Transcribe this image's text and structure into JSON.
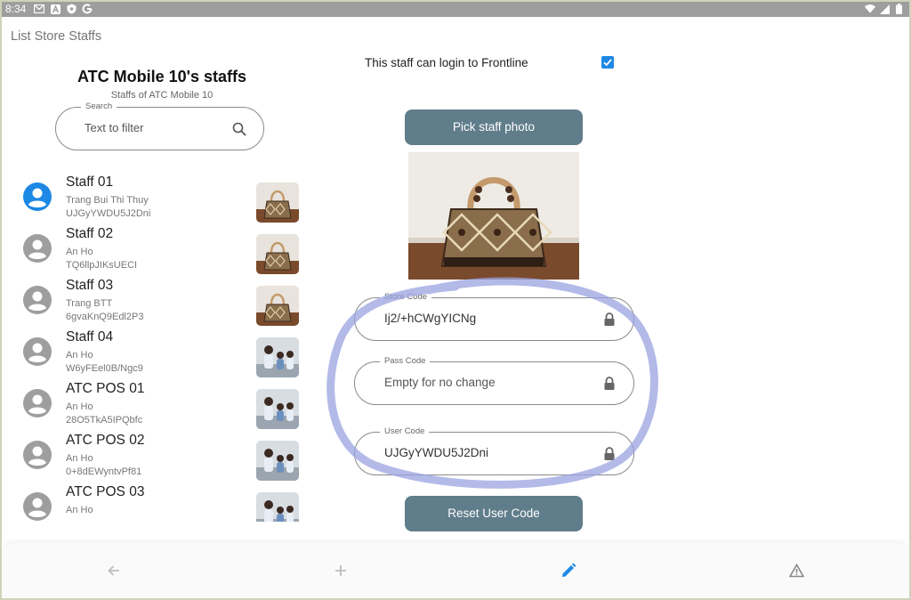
{
  "status_bar": {
    "time": "8:34",
    "left_icons": [
      "gmail-icon",
      "a-icon",
      "shield-icon",
      "google-icon"
    ],
    "right_icons": [
      "wifi-icon",
      "signal-icon",
      "battery-icon"
    ]
  },
  "app": {
    "title": "List Store Staffs"
  },
  "store": {
    "title": "ATC Mobile 10's staffs",
    "subtitle": "Staffs of ATC Mobile 10"
  },
  "search": {
    "legend": "Search",
    "placeholder": "Text to filter"
  },
  "staff": [
    {
      "name": "Staff 01",
      "person": "Trang Bui Thi Thuy",
      "code": "UJGyYWDU5J2Dni",
      "selected": true,
      "photo": "bag"
    },
    {
      "name": "Staff 02",
      "person": "An Ho",
      "code": "TQ6llpJIKsUECI",
      "selected": false,
      "photo": "bag"
    },
    {
      "name": "Staff 03",
      "person": "Trang BTT",
      "code": "6gvaKnQ9Edl2P3",
      "selected": false,
      "photo": "bag"
    },
    {
      "name": "Staff 04",
      "person": "An Ho",
      "code": "W6yFEel0B/Ngc9",
      "selected": false,
      "photo": "people"
    },
    {
      "name": "ATC POS 01",
      "person": "An Ho",
      "code": "28O5TkA5IPQbfc",
      "selected": false,
      "photo": "people"
    },
    {
      "name": "ATC POS 02",
      "person": "An Ho",
      "code": "0+8dEWyntvPf81",
      "selected": false,
      "photo": "people"
    },
    {
      "name": "ATC POS 03",
      "person": "An Ho",
      "code": "",
      "selected": false,
      "photo": "people"
    }
  ],
  "detail": {
    "login_label": "This staff can login to Frontline",
    "login_checked": true,
    "pick_photo_label": "Pick staff photo",
    "store_code": {
      "legend": "Store Code",
      "value": "Ij2/+hCWgYICNg"
    },
    "pass_code": {
      "legend": "Pass Code",
      "placeholder": "Empty for no change"
    },
    "user_code": {
      "legend": "User Code",
      "value": "UJGyYWDU5J2Dni"
    },
    "reset_label": "Reset User Code"
  },
  "bottom_nav": [
    "back-arrow-icon",
    "plus-icon",
    "pencil-icon",
    "warning-icon"
  ],
  "colors": {
    "accent": "#1e88e5",
    "button": "#607d8b",
    "annotation": "#9aa3e0"
  }
}
